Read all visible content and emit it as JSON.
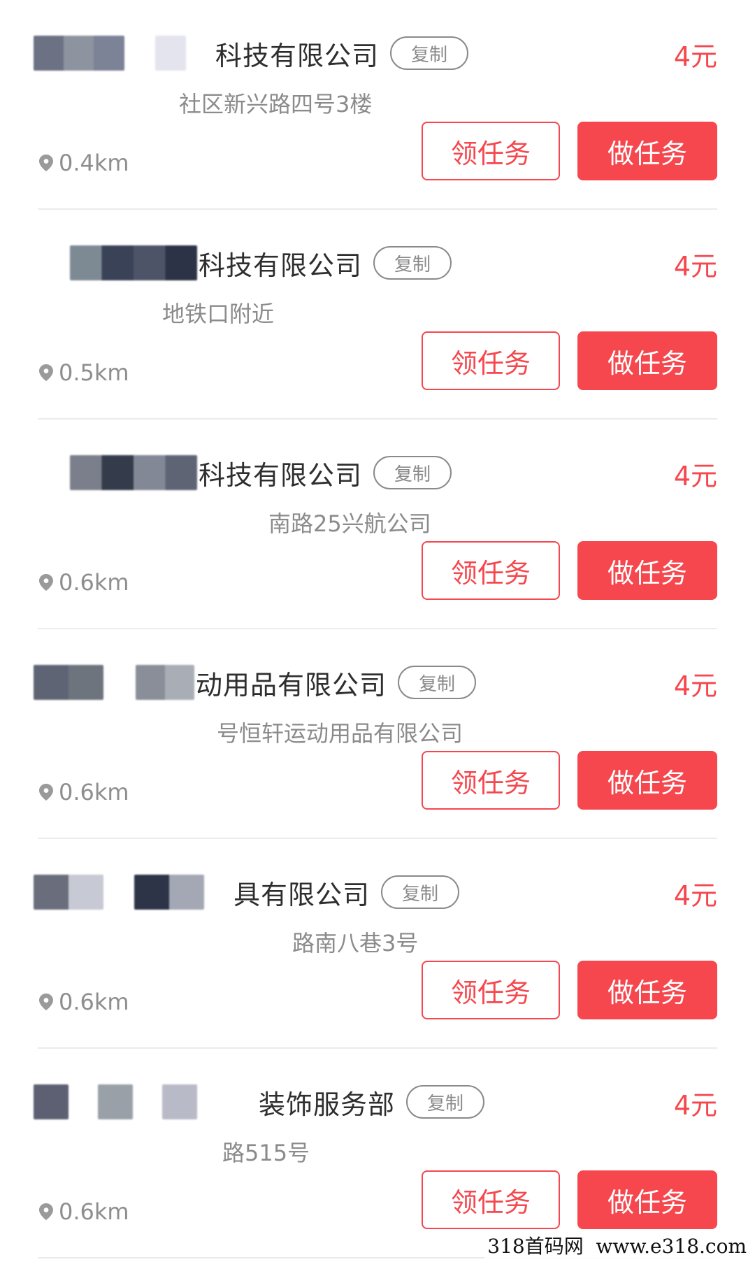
{
  "colors": {
    "accent": "#f5474d",
    "text_primary": "#2e2e2e",
    "text_secondary": "#8b8b8b",
    "divider": "#ebebeb"
  },
  "buttons": {
    "copy_label": "复制",
    "take_task_label": "领任务",
    "do_task_label": "做任务"
  },
  "icons": {
    "distance": "location-pin-icon"
  },
  "tasks": [
    {
      "name": "科技有限公司",
      "address": "社区新兴路四号3楼",
      "distance": "0.4km",
      "reward": "4元"
    },
    {
      "name": "科技有限公司",
      "address": "地铁口附近",
      "distance": "0.5km",
      "reward": "4元"
    },
    {
      "name": "科技有限公司",
      "address": "南路25兴航公司",
      "distance": "0.6km",
      "reward": "4元"
    },
    {
      "name": "动用品有限公司",
      "address": "号恒轩运动用品有限公司",
      "distance": "0.6km",
      "reward": "4元"
    },
    {
      "name": "具有限公司",
      "address": "路南八巷3号",
      "distance": "0.6km",
      "reward": "4元"
    },
    {
      "name": "装饰服务部",
      "address": "路515号",
      "distance": "0.6km",
      "reward": "4元"
    }
  ],
  "watermark": "318首码网  www.e318.com"
}
